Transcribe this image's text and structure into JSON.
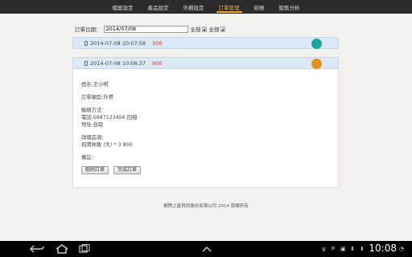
{
  "nav": {
    "items": [
      {
        "label": "檔案設定",
        "active": false
      },
      {
        "label": "產品設定",
        "active": false
      },
      {
        "label": "外觀設定",
        "active": false
      },
      {
        "label": "訂單管理",
        "active": true
      },
      {
        "label": "結帳",
        "active": false
      },
      {
        "label": "銷售分析",
        "active": false
      }
    ],
    "active_color": "#f0a830"
  },
  "filter": {
    "label": "訂單日期：",
    "date_value": "2014/07/08",
    "select1": "全部",
    "select2": "全部"
  },
  "orders": [
    {
      "datetime": "2014-07-08 10:07:58",
      "amount": "300",
      "status_color": "#1aa69c"
    },
    {
      "datetime": "2014-07-08 10:06:37",
      "amount": "900",
      "status_color": "#e8901c"
    }
  ],
  "detail": {
    "name": "姓名:王小明",
    "order_type": "訂單類型:外帶",
    "contact_label": "聯絡方法：",
    "phone": "電話:0987123456 回撥",
    "address": "地址:自取",
    "items_label": "詳細品項：",
    "item_line": "招牌丼飯 (大) * 3 900",
    "note_label": "備註：",
    "delete_button": "刪除訂單",
    "complete_button": "完成訂單"
  },
  "footer": "網際之星資訊股份有限公司 2014 版權所有",
  "system_bar": {
    "time": "10:08",
    "back_icon": "back-icon",
    "home_icon": "home-icon",
    "recent_icon": "recent-apps-icon"
  }
}
